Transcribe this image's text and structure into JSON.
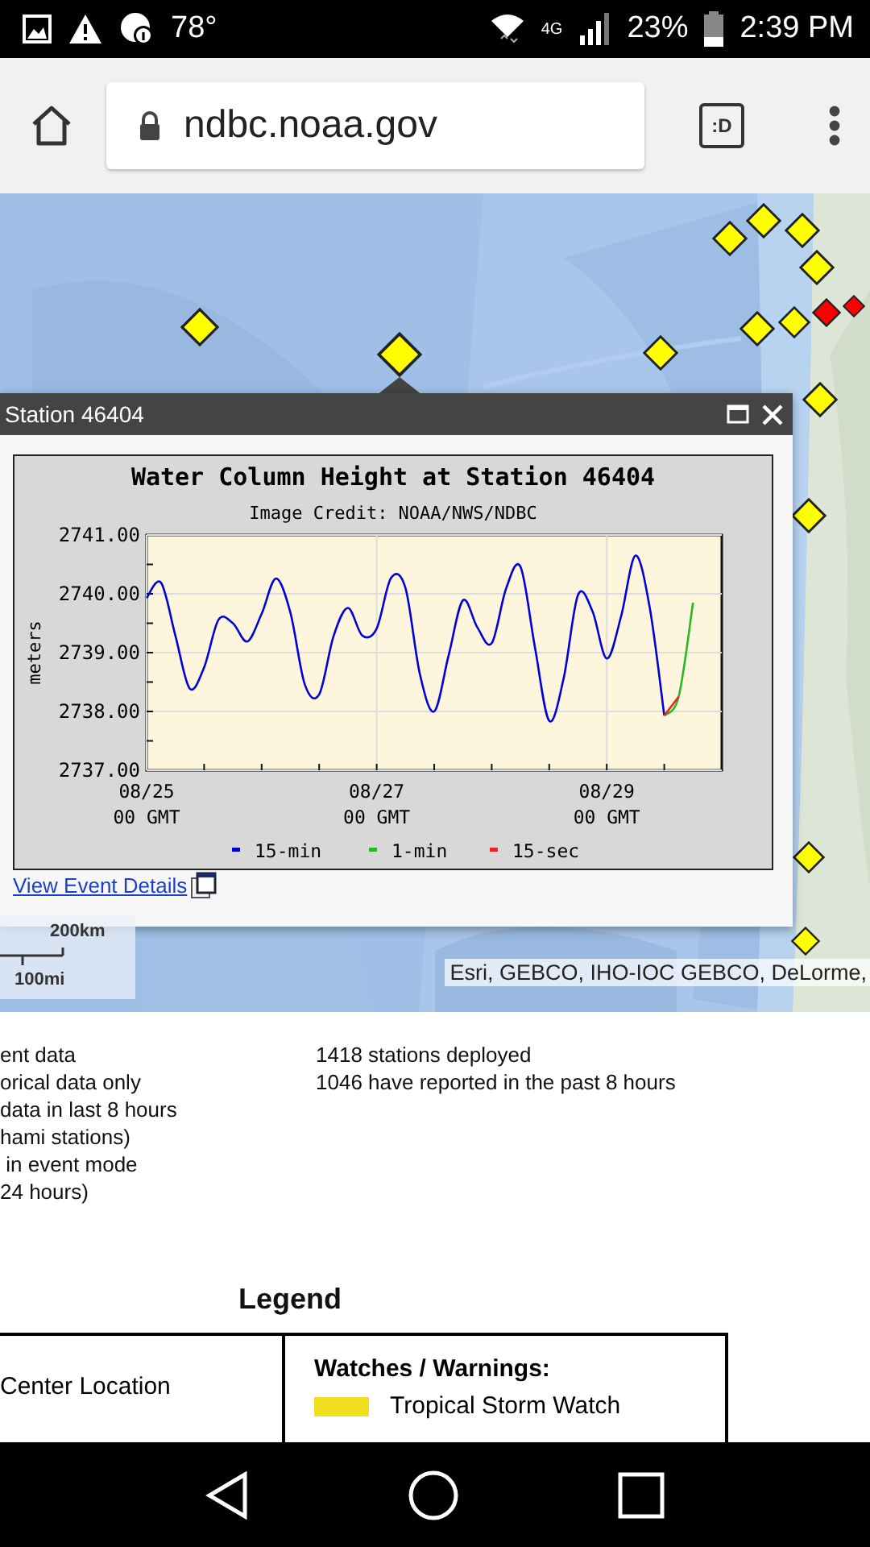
{
  "status_bar": {
    "temperature": "78°",
    "network": "4G",
    "battery": "23%",
    "time": "2:39 PM"
  },
  "browser": {
    "url": "ndbc.noaa.gov",
    "tabs_button": ":D"
  },
  "map": {
    "station_markers": [
      {
        "color": "#ffff00"
      },
      {
        "color": "#ffff00"
      },
      {
        "color": "#ffff00"
      },
      {
        "color": "#ffff00"
      },
      {
        "color": "#ffff00"
      },
      {
        "color": "#ffff00"
      },
      {
        "color": "#ffff00"
      },
      {
        "color": "#ffff00"
      },
      {
        "color": "#ffff00"
      },
      {
        "color": "#ff0000"
      },
      {
        "color": "#ff0000"
      },
      {
        "color": "#ffff00"
      },
      {
        "color": "#ffff00"
      },
      {
        "color": "#ffff00"
      },
      {
        "color": "#ffff00"
      }
    ],
    "scale": {
      "metric": "200km",
      "imperial": "100mi"
    },
    "attribution": "Esri, GEBCO, IHO-IOC GEBCO, DeLorme,"
  },
  "popup": {
    "title": "Station 46404",
    "link": "View Event Details",
    "chart_data": {
      "type": "line",
      "title": "Water Column Height at Station 46404",
      "subtitle": "Image Credit: NOAA/NWS/NDBC",
      "ylabel": "meters",
      "categories": [
        "08/25 00 GMT",
        null,
        null,
        null,
        null,
        null,
        null,
        null,
        null,
        null,
        null,
        null,
        null,
        null,
        null,
        null,
        "08/27 00 GMT",
        null,
        null,
        null,
        null,
        null,
        null,
        null,
        null,
        null,
        null,
        null,
        null,
        null,
        null,
        null,
        "08/29 00 GMT",
        null,
        null,
        null,
        null,
        null,
        null
      ],
      "series": [
        {
          "name": "15-min",
          "color": "#0000dd",
          "values": [
            2739.93,
            2740.19,
            2739.29,
            2738.39,
            2738.75,
            2739.56,
            2739.5,
            2739.19,
            2739.66,
            2740.26,
            2739.68,
            2738.46,
            2738.29,
            2739.28,
            2739.76,
            2739.29,
            2739.41,
            2740.27,
            2740.1,
            2738.64,
            2738.0,
            2738.95,
            2739.89,
            2739.43,
            2739.16,
            2740.09,
            2740.46,
            2739.1,
            2737.84,
            2738.56,
            2739.98,
            2739.71,
            2738.9,
            2739.62,
            2740.65,
            2739.75,
            2737.93,
            null,
            null
          ]
        },
        {
          "name": "1-min",
          "color": "#22bb22",
          "values": [
            null,
            null,
            null,
            null,
            null,
            null,
            null,
            null,
            null,
            null,
            null,
            null,
            null,
            null,
            null,
            null,
            null,
            null,
            null,
            null,
            null,
            null,
            null,
            null,
            null,
            null,
            null,
            null,
            null,
            null,
            null,
            null,
            null,
            null,
            null,
            null,
            2737.93,
            2738.25,
            2739.85
          ]
        },
        {
          "name": "15-sec",
          "color": "#ee2222",
          "values": [
            null,
            null,
            null,
            null,
            null,
            null,
            null,
            null,
            null,
            null,
            null,
            null,
            null,
            null,
            null,
            null,
            null,
            null,
            null,
            null,
            null,
            null,
            null,
            null,
            null,
            null,
            null,
            null,
            null,
            null,
            null,
            null,
            null,
            null,
            null,
            null,
            2737.93,
            2738.25,
            null
          ]
        }
      ],
      "ylim": [
        2737,
        2741
      ],
      "grid": true,
      "legend": "bottom",
      "yticks": [
        {
          "value": 2737,
          "label": "2737.00"
        },
        {
          "value": 2738,
          "label": "2738.00"
        },
        {
          "value": 2739,
          "label": "2739.00"
        },
        {
          "value": 2740,
          "label": "2740.00"
        },
        {
          "value": 2741,
          "label": "2741.00"
        }
      ]
    }
  },
  "summary": {
    "left_lines": [
      "ent data",
      "orical data only",
      "data in last 8 hours",
      "hami stations)",
      " in event mode",
      "24 hours)"
    ],
    "right_lines": [
      "1418 stations deployed",
      "1046 have reported in the past 8 hours"
    ]
  },
  "legend": {
    "title": "Legend",
    "left_cell": "Center Location",
    "heading": "Watches / Warnings:",
    "items": [
      {
        "label": "Tropical Storm Watch",
        "color": "#f2e020"
      }
    ]
  }
}
